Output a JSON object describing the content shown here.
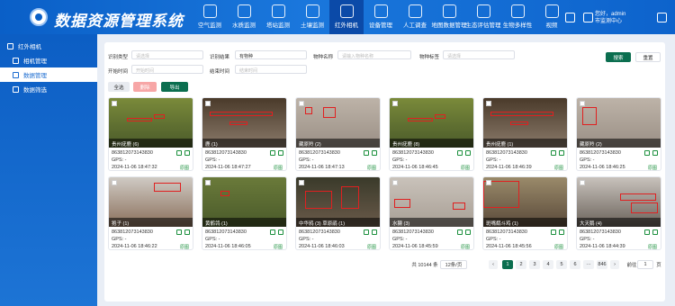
{
  "header": {
    "title": "数据资源管理系统",
    "user_greeting": "您好，admin",
    "user_org": "市监测中心"
  },
  "nav": [
    {
      "label": "空气监测",
      "icon": "cloud-icon"
    },
    {
      "label": "水质监测",
      "icon": "water-icon"
    },
    {
      "label": "塔站监测",
      "icon": "tower-icon"
    },
    {
      "label": "土壤监测",
      "icon": "soil-icon"
    },
    {
      "label": "红外相机",
      "icon": "camera-icon",
      "active": true
    },
    {
      "label": "设备管理",
      "icon": "device-icon"
    },
    {
      "label": "人工调查",
      "icon": "survey-icon"
    },
    {
      "label": "地图数据管理",
      "icon": "map-icon"
    },
    {
      "label": "生态评估管理",
      "icon": "eco-icon"
    },
    {
      "label": "生物多样性",
      "icon": "bio-icon"
    },
    {
      "label": "视频",
      "icon": "video-icon"
    }
  ],
  "sidebar": {
    "group": "红外相机",
    "items": [
      {
        "label": "相机管理",
        "active": false
      },
      {
        "label": "数据管理",
        "active": true
      },
      {
        "label": "数据筛选",
        "active": false
      }
    ]
  },
  "filters": {
    "recognition_type": {
      "label": "识别类型",
      "placeholder": "请选择"
    },
    "recognition_result": {
      "label": "识别结果",
      "value": "有物种"
    },
    "species_name": {
      "label": "物种名称",
      "placeholder": "请输入物种名称"
    },
    "species_tag": {
      "label": "物种标签",
      "placeholder": "请选择"
    },
    "start_time": {
      "label": "开始时间",
      "placeholder": "开始时间"
    },
    "end_time": {
      "label": "结束时间",
      "placeholder": "结束时间"
    }
  },
  "buttons": {
    "search": "搜索",
    "reset": "重置",
    "select_all": "全选",
    "delete": "删除",
    "export": "导出"
  },
  "cards": [
    {
      "caption": "贵州疣鹿 (6)",
      "device": "863812073143830",
      "gps": "GPS: -",
      "time": "2024-11-06 18:47:32",
      "detail": "原图"
    },
    {
      "caption": "鹿 (1)",
      "device": "863812073143830",
      "gps": "GPS: -",
      "time": "2024-11-06 18:47:27",
      "detail": "原图"
    },
    {
      "caption": "藏原羚 (2)",
      "device": "863812073143830",
      "gps": "GPS: -",
      "time": "2024-11-06 18:47:13",
      "detail": "原图"
    },
    {
      "caption": "贵州疣鹿 (8)",
      "device": "863812073143830",
      "gps": "GPS: -",
      "time": "2024-11-06 18:46:45",
      "detail": "原图"
    },
    {
      "caption": "贵州疣鹿 (1)",
      "device": "863812073143830",
      "gps": "GPS: -",
      "time": "2024-11-06 18:46:39",
      "detail": "原图"
    },
    {
      "caption": "藏原羚 (2)",
      "device": "863812073143830",
      "gps": "GPS: -",
      "time": "2024-11-06 18:46:25",
      "detail": "原图"
    },
    {
      "caption": "狍子 (1)",
      "device": "863812073143830",
      "gps": "GPS: -",
      "time": "2024-11-06 18:46:22",
      "detail": "原图"
    },
    {
      "caption": "黄鹡鸰 (1)",
      "device": "863812073143830",
      "gps": "GPS: -",
      "time": "2024-11-06 18:46:05",
      "detail": "原图"
    },
    {
      "caption": "中华鸦 (3)  草原鹃 (1)",
      "device": "863812073143830",
      "gps": "GPS: -",
      "time": "2024-11-06 18:46:03",
      "detail": "原图"
    },
    {
      "caption": "水獭 (3)",
      "device": "863812073143830",
      "gps": "GPS: -",
      "time": "2024-11-06 18:45:59",
      "detail": "原图"
    },
    {
      "caption": "斑嘴鹬斗鸡 (1)",
      "device": "863812073143830",
      "gps": "GPS: -",
      "time": "2024-11-06 18:45:56",
      "detail": "原图"
    },
    {
      "caption": "大天鹅 (4)",
      "device": "863812073143830",
      "gps": "GPS: -",
      "time": "2024-11-06 18:44:39",
      "detail": "原图"
    }
  ],
  "pagination": {
    "total": "共 10144 条",
    "page_size": "12条/页",
    "pages": [
      "1",
      "2",
      "3",
      "4",
      "5",
      "6",
      "···",
      "846"
    ],
    "goto_label": "前往",
    "goto_value": "1",
    "goto_suffix": "页"
  }
}
